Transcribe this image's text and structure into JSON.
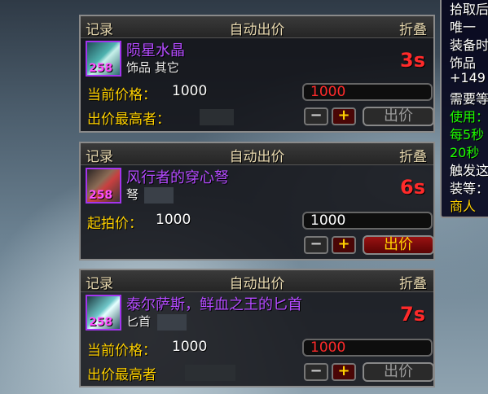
{
  "loot_frames": [
    {
      "header": {
        "left": "记录",
        "center": "自动出价",
        "right": "折叠"
      },
      "item_name": "陨星水晶",
      "item_type": "饰品 其它",
      "item_level": "258",
      "timer": "3s",
      "price_label": "当前价格：",
      "price_value": "1000",
      "bid_input": "1000",
      "bidder_label": "出价最高者：",
      "minus_label": "−",
      "plus_label": "+",
      "bid_button": "出价"
    },
    {
      "header": {
        "left": "记录",
        "center": "自动出价",
        "right": "折叠"
      },
      "item_name": "风行者的穿心弩",
      "item_type": "弩",
      "item_level": "258",
      "timer": "6s",
      "price_label": "起拍价：",
      "price_value": "1000",
      "bid_input": "1000",
      "minus_label": "−",
      "plus_label": "+",
      "bid_button": "出价"
    },
    {
      "header": {
        "left": "记录",
        "center": "自动出价",
        "right": "折叠"
      },
      "item_name": "泰尔萨斯，鲜血之王的匕首",
      "item_type": "匕首",
      "item_level": "258",
      "timer": "7s",
      "price_label": "当前价格：",
      "price_value": "1000",
      "bid_input": "1000",
      "bidder_label": "出价最高者",
      "minus_label": "−",
      "plus_label": "+",
      "bid_button": "出价"
    }
  ],
  "tooltip": {
    "lines": [
      "拾取后",
      "唯一",
      "装备时",
      "饰品",
      "+149",
      "需要等",
      "使用：",
      "每5秒",
      "20秒",
      "触发这",
      "装等：",
      "商人"
    ]
  },
  "colors": {
    "epic_purple": "#b44bff",
    "timer_red": "#ff2a2a",
    "label_gold": "#ffd100",
    "tooltip_green": "#1eff00"
  }
}
